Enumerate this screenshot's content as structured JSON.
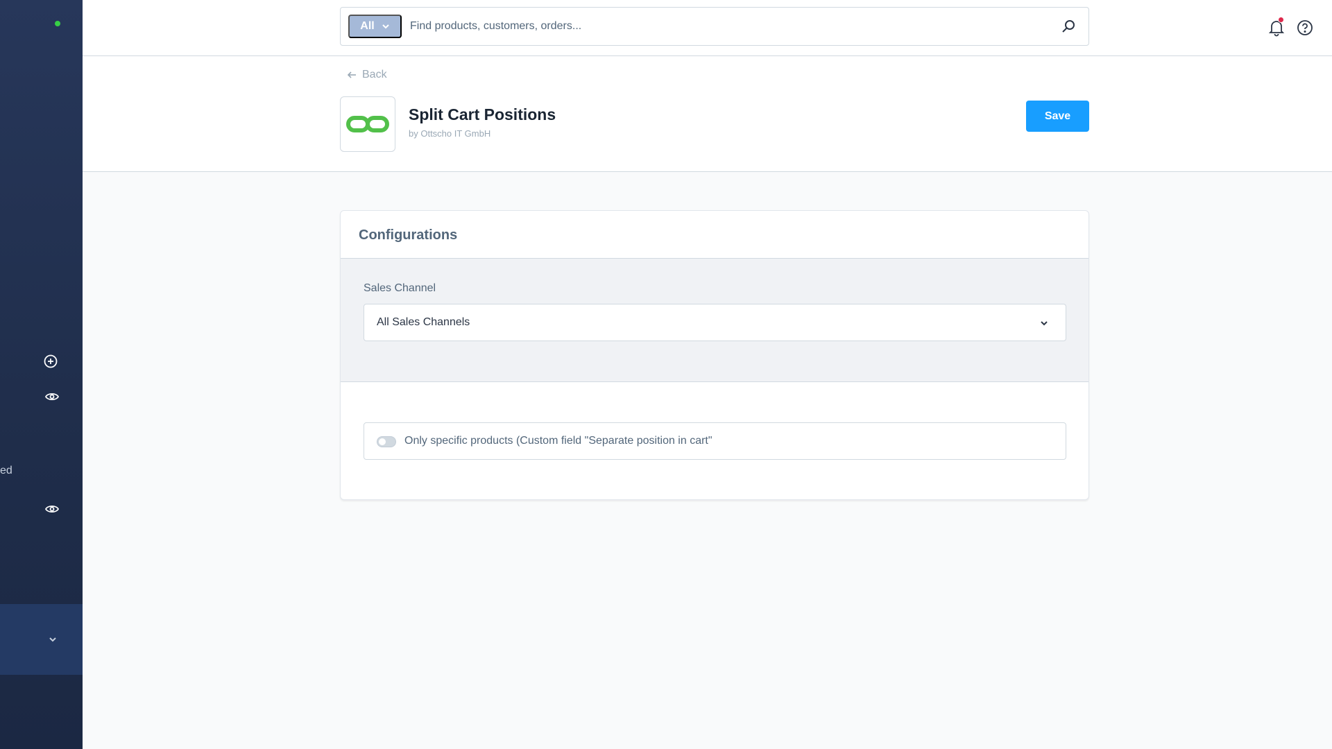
{
  "sidebar": {
    "partial_label": "ed",
    "colors": {
      "background": "#27375a",
      "status": "#37d046",
      "panel": "#243a64"
    }
  },
  "search": {
    "type_label": "All",
    "placeholder": "Find products, customers, orders..."
  },
  "header": {
    "back_label": "Back",
    "title": "Split Cart Positions",
    "subtitle": "by Ottscho IT GmbH",
    "save_label": "Save"
  },
  "config": {
    "card_title": "Configurations",
    "sales_channel_label": "Sales Channel",
    "sales_channel_value": "All Sales Channels",
    "toggle_label": "Only specific products (Custom field \"Separate position in cart\""
  },
  "colors": {
    "accent": "#189eff",
    "logo_green": "#52c04a",
    "notification": "#de294c"
  }
}
